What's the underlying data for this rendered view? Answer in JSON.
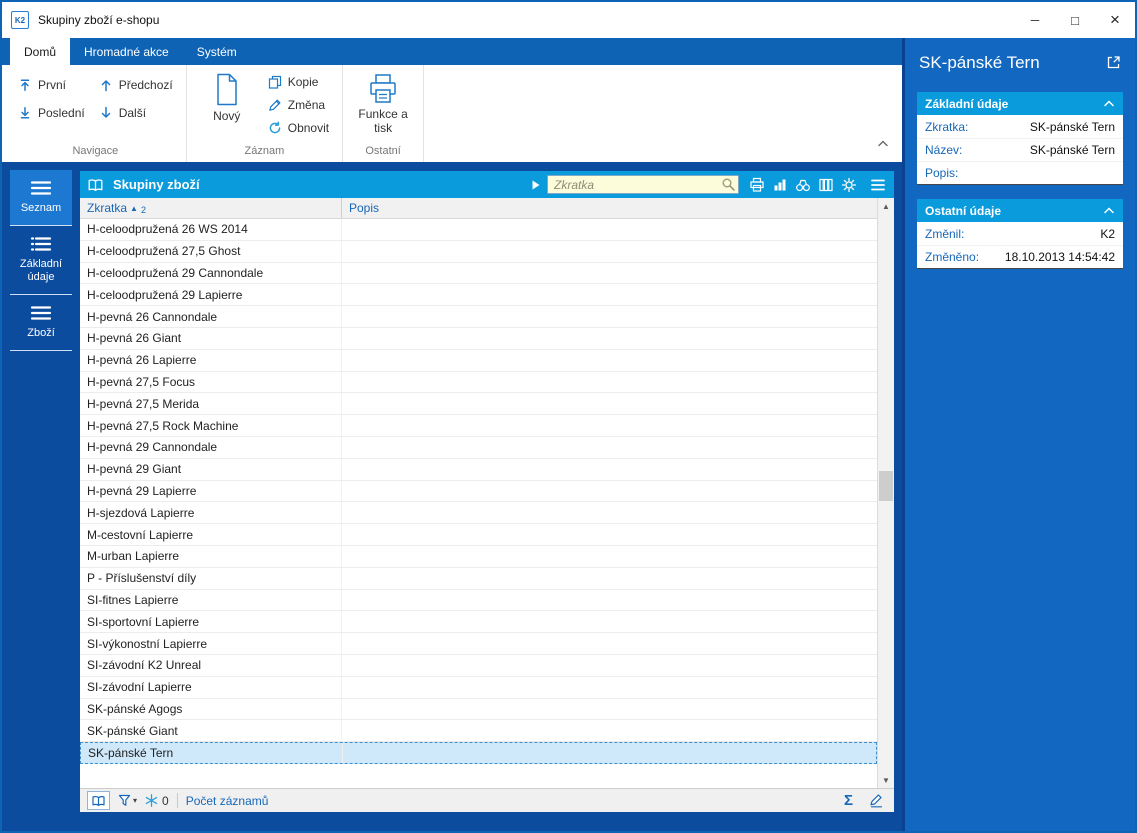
{
  "colors": {
    "frame_blue": "#0f63b5",
    "work_blue": "#0c4c9e",
    "panel_blue": "#1268c0",
    "cyan_header": "#0a9bdc",
    "accent_text_blue": "#1767b8",
    "selection_bg": "#cfe9fb",
    "search_bg": "#fdfcda"
  },
  "window": {
    "title": "Skupiny zboží e-shopu",
    "icon_text": "K2",
    "controls": {
      "minimize": "─",
      "maximize": "□",
      "close": "×"
    }
  },
  "ribbon": {
    "tabs": [
      {
        "label": "Domů",
        "active": true
      },
      {
        "label": "Hromadné akce",
        "active": false
      },
      {
        "label": "Systém",
        "active": false
      }
    ],
    "nav": {
      "first": "První",
      "last": "Poslední",
      "previous": "Předchozí",
      "next": "Další"
    },
    "record": {
      "new": "Nový",
      "copy": "Kopie",
      "change": "Změna",
      "refresh": "Obnovit"
    },
    "other": {
      "functions_print": "Funkce a tisk"
    },
    "group_labels": [
      "Navigace",
      "Záznam",
      "Ostatní"
    ]
  },
  "sidebar": {
    "items": [
      {
        "label": "Seznam",
        "active": true
      },
      {
        "label": "Základní údaje",
        "active": false
      },
      {
        "label": "Zboží",
        "active": false
      }
    ]
  },
  "main": {
    "header": {
      "title": "Skupiny zboží",
      "search_placeholder": "Zkratka"
    },
    "table": {
      "columns": [
        {
          "label": "Zkratka"
        },
        {
          "label": "Popis"
        }
      ],
      "sort": {
        "icon": "▲",
        "order": "2"
      },
      "rows": [
        {
          "zkratka": "H-celoodpružená 26 WS 2014",
          "popis": ""
        },
        {
          "zkratka": "H-celoodpružená 27,5 Ghost",
          "popis": ""
        },
        {
          "zkratka": "H-celoodpružená 29 Cannondale",
          "popis": ""
        },
        {
          "zkratka": "H-celoodpružená 29 Lapierre",
          "popis": ""
        },
        {
          "zkratka": "H-pevná 26 Cannondale",
          "popis": ""
        },
        {
          "zkratka": "H-pevná 26 Giant",
          "popis": ""
        },
        {
          "zkratka": "H-pevná 26 Lapierre",
          "popis": ""
        },
        {
          "zkratka": "H-pevná 27,5 Focus",
          "popis": ""
        },
        {
          "zkratka": "H-pevná 27,5 Merida",
          "popis": ""
        },
        {
          "zkratka": "H-pevná 27,5 Rock Machine",
          "popis": ""
        },
        {
          "zkratka": "H-pevná 29 Cannondale",
          "popis": ""
        },
        {
          "zkratka": "H-pevná 29 Giant",
          "popis": ""
        },
        {
          "zkratka": "H-pevná 29 Lapierre",
          "popis": ""
        },
        {
          "zkratka": "H-sjezdová Lapierre",
          "popis": ""
        },
        {
          "zkratka": "M-cestovní Lapierre",
          "popis": ""
        },
        {
          "zkratka": "M-urban Lapierre",
          "popis": ""
        },
        {
          "zkratka": "P - Příslušenství díly",
          "popis": ""
        },
        {
          "zkratka": "SI-fitnes Lapierre",
          "popis": ""
        },
        {
          "zkratka": "SI-sportovní Lapierre",
          "popis": ""
        },
        {
          "zkratka": "SI-výkonostní Lapierre",
          "popis": ""
        },
        {
          "zkratka": "SI-závodní K2 Unreal",
          "popis": ""
        },
        {
          "zkratka": "SI-závodní Lapierre",
          "popis": ""
        },
        {
          "zkratka": "SK-pánské Agogs",
          "popis": ""
        },
        {
          "zkratka": "SK-pánské Giant",
          "popis": ""
        },
        {
          "zkratka": "SK-pánské Tern",
          "popis": "",
          "selected": true
        }
      ]
    },
    "status": {
      "count": "0",
      "records_label": "Počet záznamů"
    }
  },
  "icons": {
    "sigma": "Σ",
    "scroll_up": "▲",
    "scroll_down": "▼",
    "filter_caret": "▾"
  },
  "detail": {
    "title": "SK-pánské Tern",
    "sections": [
      {
        "title": "Základní údaje",
        "fields": [
          {
            "label": "Zkratka:",
            "value": "SK-pánské Tern"
          },
          {
            "label": "Název:",
            "value": "SK-pánské Tern"
          },
          {
            "label": "Popis:",
            "value": ""
          }
        ]
      },
      {
        "title": "Ostatní údaje",
        "fields": [
          {
            "label": "Změnil:",
            "value": "K2"
          },
          {
            "label": "Změněno:",
            "value": "18.10.2013 14:54:42"
          }
        ]
      }
    ]
  }
}
